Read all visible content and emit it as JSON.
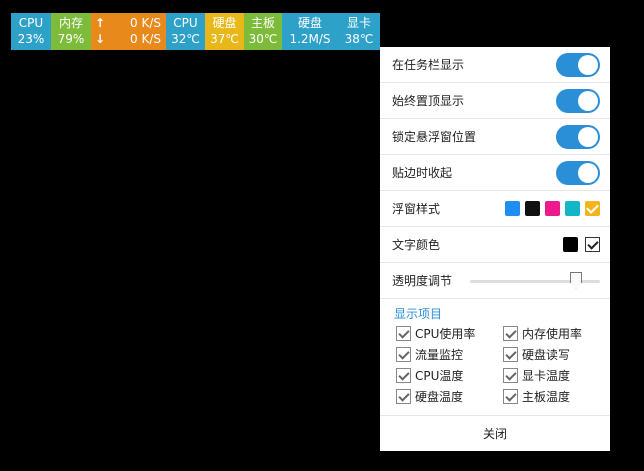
{
  "monitor": {
    "cells": [
      {
        "name": "cpu-usage",
        "label": "CPU",
        "value": "23%",
        "bg": "#2ea1c9",
        "width": 40
      },
      {
        "name": "memory-usage",
        "label": "内存",
        "value": "79%",
        "bg": "#7dbb3a",
        "width": 40
      },
      {
        "name": "upload-speed",
        "label": "0 K/S",
        "value": "0 K/S",
        "bg": "#e8891b",
        "width": 75
      },
      {
        "name": "cpu-temp",
        "label": "CPU",
        "value": "32℃",
        "bg": "#2ea1c9",
        "width": 39
      },
      {
        "name": "disk-temp",
        "label": "硬盘",
        "value": "37℃",
        "bg": "#e8b81b",
        "width": 39
      },
      {
        "name": "board-temp",
        "label": "主板",
        "value": "30℃",
        "bg": "#7dbb3a",
        "width": 38
      },
      {
        "name": "disk-rw",
        "label": "硬盘",
        "value": "1.2M/S",
        "bg": "#2ea1c9",
        "width": 56
      },
      {
        "name": "gpu-temp",
        "label": "显卡",
        "value": "38℃",
        "bg": "#2ea1c9",
        "width": 42
      }
    ],
    "net": {
      "up_arrow": "↑",
      "down_arrow": "↓",
      "up": "0 K/S",
      "down": "0 K/S"
    }
  },
  "panel": {
    "toggles": [
      {
        "name": "show-in-taskbar",
        "label": "在任务栏显示",
        "on": true
      },
      {
        "name": "always-on-top",
        "label": "始终置顶显示",
        "on": true
      },
      {
        "name": "lock-position",
        "label": "锁定悬浮窗位置",
        "on": true
      },
      {
        "name": "snap-collapse",
        "label": "贴边时收起",
        "on": true
      }
    ],
    "style": {
      "label": "浮窗样式",
      "swatches": [
        "#1e8ef0",
        "#111111",
        "#ec1a8c",
        "#15b5c8",
        "#f2b51b"
      ],
      "selected": 4
    },
    "text_color": {
      "label": "文字颜色",
      "color": "#000000",
      "checked": true
    },
    "opacity": {
      "label": "透明度调节",
      "value": 0.85
    },
    "display": {
      "title": "显示项目",
      "items": [
        {
          "name": "cpu-usage",
          "label": "CPU使用率",
          "checked": true
        },
        {
          "name": "memory-usage",
          "label": "内存使用率",
          "checked": true
        },
        {
          "name": "traffic-monitor",
          "label": "流量监控",
          "checked": true
        },
        {
          "name": "disk-rw",
          "label": "硬盘读写",
          "checked": true
        },
        {
          "name": "cpu-temp",
          "label": "CPU温度",
          "checked": true
        },
        {
          "name": "gpu-temp",
          "label": "显卡温度",
          "checked": true
        },
        {
          "name": "disk-temp",
          "label": "硬盘温度",
          "checked": true
        },
        {
          "name": "board-temp",
          "label": "主板温度",
          "checked": true
        }
      ]
    },
    "close_label": "关闭",
    "accent": "#2b8fd8"
  }
}
